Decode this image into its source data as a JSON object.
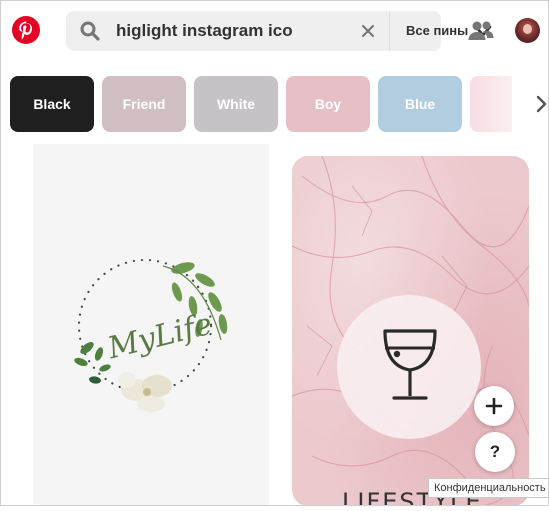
{
  "header": {
    "search_value": "higlight instagram ico",
    "scope_label": "Все пины"
  },
  "colors": {
    "pinterest_red": "#e60023",
    "chip_black": "#1f1f1f",
    "chip_friend": "#d2bfc4",
    "chip_white": "#c6c3c7",
    "chip_boy": "#e7bfc6",
    "chip_blue": "#b2cde0",
    "chip_partial": "#f7dde2"
  },
  "chips": [
    {
      "label": "Black"
    },
    {
      "label": "Friend"
    },
    {
      "label": "White"
    },
    {
      "label": "Boy"
    },
    {
      "label": "Blue"
    }
  ],
  "pins": {
    "mylife_text": "MyLife",
    "lifestyle_text": "LIFESTYLE"
  },
  "floating": {
    "help_label": "?",
    "privacy_label": "Конфиденциальность"
  },
  "icons": [
    "pinterest-logo-icon",
    "search-icon",
    "close-icon",
    "chevron-down-icon",
    "people-icon",
    "chevron-right-icon",
    "plus-icon",
    "wine-glass-icon"
  ]
}
